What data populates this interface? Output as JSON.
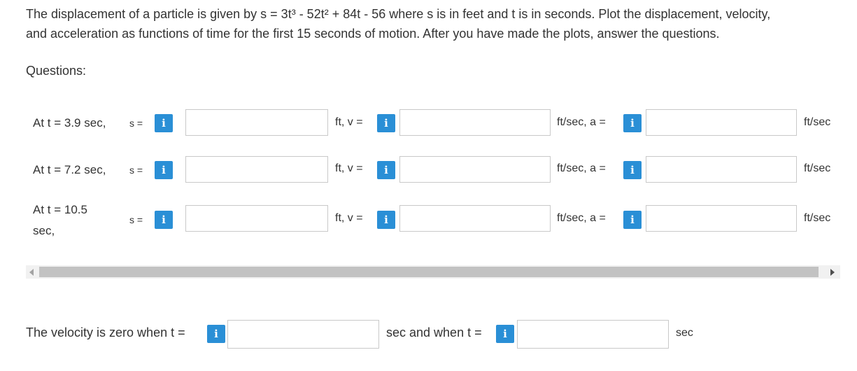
{
  "problem": {
    "line1": "The displacement of a particle is given by s = 3t³ - 52t² + 84t - 56 where s is in feet and t is in seconds. Plot the displacement, velocity,",
    "line2": "and acceleration as functions of time for the first 15 seconds of motion. After you have made the plots, answer the questions."
  },
  "questions_heading": "Questions:",
  "info_glyph": "i",
  "rows": [
    {
      "label": "At t = 3.9 sec,",
      "s_eq": "s =",
      "ft_v": "ft, v =",
      "fts_a": "ft/sec, a =",
      "end_unit": "ft/sec",
      "s_value": "",
      "v_value": "",
      "a_value": ""
    },
    {
      "label": "At t = 7.2 sec,",
      "s_eq": "s =",
      "ft_v": "ft, v =",
      "fts_a": "ft/sec, a =",
      "end_unit": "ft/sec",
      "s_value": "",
      "v_value": "",
      "a_value": ""
    },
    {
      "label_line1": "At t = 10.5",
      "label_line2": "sec,",
      "s_eq": "s =",
      "ft_v": "ft, v =",
      "fts_a": "ft/sec, a =",
      "end_unit": "ft/sec",
      "s_value": "",
      "v_value": "",
      "a_value": ""
    }
  ],
  "final": {
    "prefix": "The velocity is zero when t =",
    "middle": "sec and when t =",
    "suffix": "sec",
    "t1_value": "",
    "t2_value": ""
  },
  "colors": {
    "info_button": "#2a8fd6",
    "text": "#333333",
    "input_border": "#c9c9c9"
  }
}
